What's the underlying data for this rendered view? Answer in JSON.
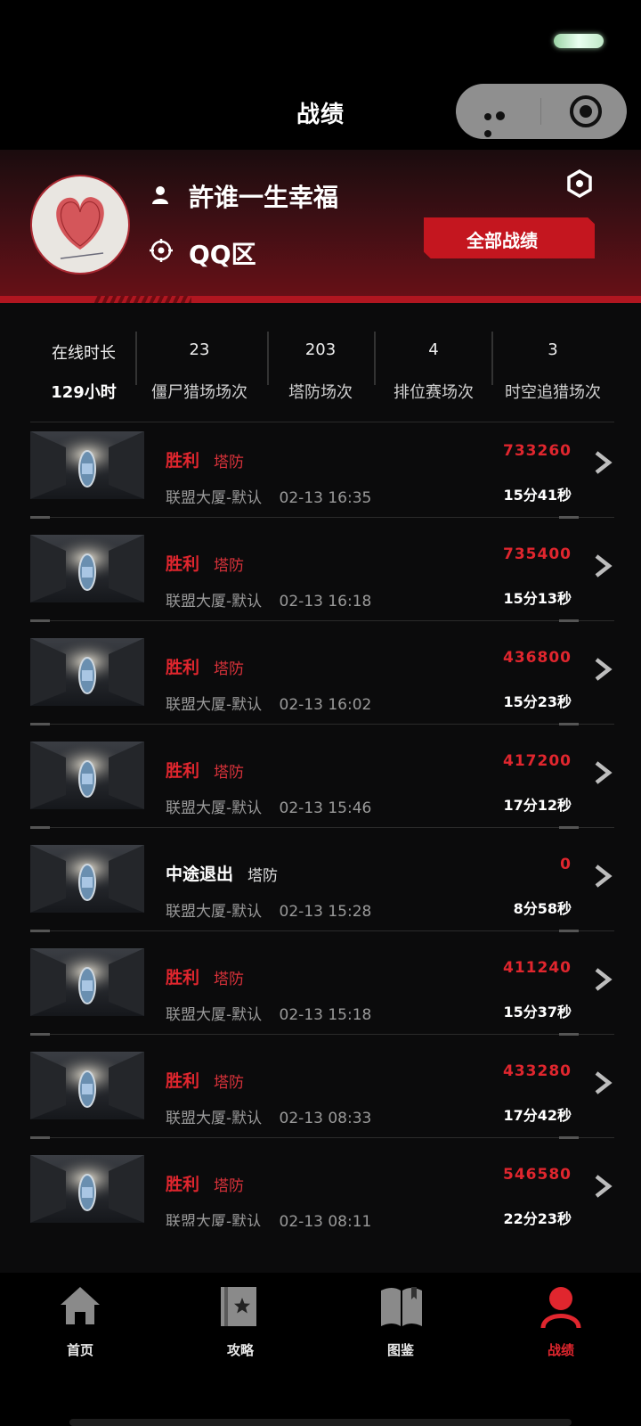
{
  "nav": {
    "title": "战绩"
  },
  "profile": {
    "name": "許谁一生幸福",
    "server": "QQ区",
    "filter_label": "全部战绩"
  },
  "stats": [
    {
      "top": "在线时长",
      "bottom": "129小时"
    },
    {
      "top": "23",
      "bottom": "僵尸猎场场次"
    },
    {
      "top": "203",
      "bottom": "塔防场次"
    },
    {
      "top": "4",
      "bottom": "排位赛场次"
    },
    {
      "top": "3",
      "bottom": "时空追猎场次"
    }
  ],
  "records": [
    {
      "result": "胜利",
      "mode": "塔防",
      "map": "联盟大厦-默认",
      "time": "02-13 16:35",
      "score": "733260",
      "duration": "15分41秒"
    },
    {
      "result": "胜利",
      "mode": "塔防",
      "map": "联盟大厦-默认",
      "time": "02-13 16:18",
      "score": "735400",
      "duration": "15分13秒"
    },
    {
      "result": "胜利",
      "mode": "塔防",
      "map": "联盟大厦-默认",
      "time": "02-13 16:02",
      "score": "436800",
      "duration": "15分23秒"
    },
    {
      "result": "胜利",
      "mode": "塔防",
      "map": "联盟大厦-默认",
      "time": "02-13 15:46",
      "score": "417200",
      "duration": "17分12秒"
    },
    {
      "result": "中途退出",
      "mode": "塔防",
      "map": "联盟大厦-默认",
      "time": "02-13 15:28",
      "score": "0",
      "duration": "8分58秒"
    },
    {
      "result": "胜利",
      "mode": "塔防",
      "map": "联盟大厦-默认",
      "time": "02-13 15:18",
      "score": "411240",
      "duration": "15分37秒"
    },
    {
      "result": "胜利",
      "mode": "塔防",
      "map": "联盟大厦-默认",
      "time": "02-13 08:33",
      "score": "433280",
      "duration": "17分42秒"
    },
    {
      "result": "胜利",
      "mode": "塔防",
      "map": "联盟大厦-默认",
      "time": "02-13 08:11",
      "score": "546580",
      "duration": "22分23秒"
    }
  ],
  "tabs": [
    {
      "label": "首页",
      "icon": "home-icon"
    },
    {
      "label": "攻略",
      "icon": "guide-book-icon"
    },
    {
      "label": "图鉴",
      "icon": "open-book-icon"
    },
    {
      "label": "战绩",
      "icon": "user-icon"
    }
  ],
  "colors": {
    "accent": "#e0262e",
    "background": "#0b0b0c",
    "banner": "#6a1017"
  }
}
